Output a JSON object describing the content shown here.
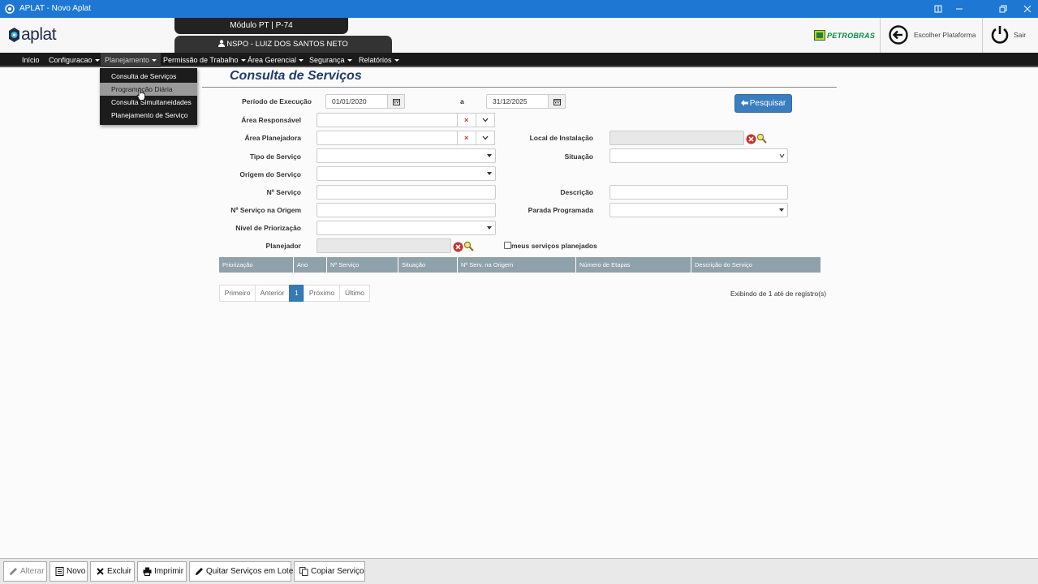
{
  "window": {
    "title": "APLAT - Novo Aplat"
  },
  "header": {
    "logo_text": "aplat",
    "module_tab": "Módulo PT | P-74",
    "user_tab": "NSPO - LUIZ DOS SANTOS NETO",
    "brand": "PETROBRAS",
    "choose_platform": "Escolher Plataforma",
    "logout": "Sair"
  },
  "nav": {
    "items": [
      "Início",
      "Configuracao",
      "Planejamento",
      "Permissão de Trabalho",
      "Área Gerencial",
      "Segurança",
      "Relatórios"
    ]
  },
  "dropdown": {
    "items": [
      "Consulta de Serviços",
      "Programação Diária",
      "Consulta Simultaneidades",
      "Planejamento de Serviço"
    ]
  },
  "form": {
    "title": "Consulta de Serviços",
    "periodo_label": "Período de Execução",
    "date_from": "01/01/2020",
    "date_sep": "a",
    "date_to": "31/12/2025",
    "search_button": "Pesquisar",
    "area_responsavel": "Área Responsável",
    "area_planejadora": "Área Planejadora",
    "tipo_servico": "Tipo de Serviço",
    "origem_servico": "Origem do Serviço",
    "num_servico": "Nº Serviço",
    "num_servico_origem": "Nº Serviço na Origem",
    "nivel_priorizacao": "Nível de Priorização",
    "planejador": "Planejador",
    "local_instalacao": "Local de Instalação",
    "situacao": "Situação",
    "descricao": "Descrição",
    "parada_programada": "Parada Programada",
    "meus_servicos": "meus serviços planejados"
  },
  "table": {
    "columns": [
      "Priorização",
      "Ano",
      "Nº Serviço",
      "Situação",
      "Nº Serv. na Origem",
      "Número de Etapas",
      "Descrição do Serviço"
    ]
  },
  "pagination": {
    "first": "Primeiro",
    "prev": "Anterior",
    "current": "1",
    "next": "Próximo",
    "last": "Último",
    "records": "Exibindo de 1 até de registro(s)"
  },
  "toolbar": {
    "alterar": "Alterar",
    "novo": "Novo",
    "excluir": "Excluir",
    "imprimir": "Imprimir",
    "quitar": "Quitar Serviços em Lote",
    "copiar": "Copiar Serviço"
  },
  "colors": {
    "titlebar": "#1e78d3",
    "primary": "#3a7ebf",
    "table_header": "#8fa1aa",
    "petrobras_green": "#0a8a44"
  }
}
